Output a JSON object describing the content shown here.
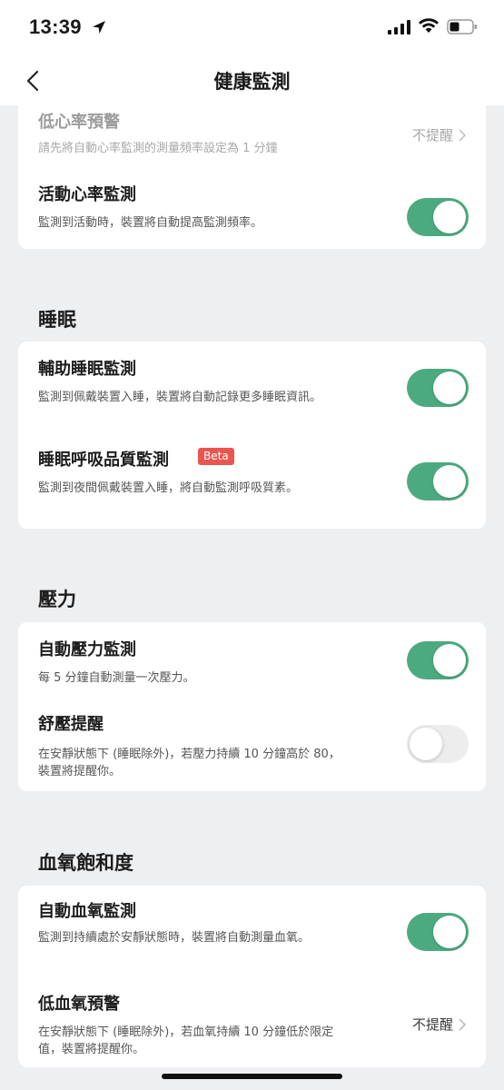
{
  "status": {
    "time": "13:39"
  },
  "nav": {
    "title": "健康監測"
  },
  "heart": {
    "low_hr": {
      "title": "低心率預警",
      "desc": "請先將自動心率監測的測量頻率設定為 1 分鐘",
      "value": "不提醒"
    },
    "activity_hr": {
      "title": "活動心率監測",
      "desc": "監測到活動時，裝置將自動提高監測頻率。",
      "toggle": true
    }
  },
  "sleep": {
    "header": "睡眠",
    "assist": {
      "title": "輔助睡眠監測",
      "desc": "監測到佩戴裝置入睡，裝置將自動記錄更多睡眠資訊。",
      "toggle": true
    },
    "breathing": {
      "title": "睡眠呼吸品質監測",
      "badge": "Beta",
      "desc": "監測到夜間佩戴裝置入睡，將自動監測呼吸質素。",
      "toggle": true
    }
  },
  "stress": {
    "header": "壓力",
    "auto": {
      "title": "自動壓力監測",
      "desc": "每 5 分鐘自動測量一次壓力。",
      "toggle": true
    },
    "relax": {
      "title": "舒壓提醒",
      "desc": "在安靜狀態下 (睡眠除外)，若壓力持續 10 分鐘高於 80，裝置將提醒你。",
      "toggle": false
    }
  },
  "spo2": {
    "header": "血氧飽和度",
    "auto": {
      "title": "自動血氧監測",
      "desc": "監測到持續處於安靜狀態時，裝置將自動測量血氧。",
      "toggle": true
    },
    "low": {
      "title": "低血氧預警",
      "desc": "在安靜狀態下 (睡眠除外)，若血氧持續 10 分鐘低於限定值，裝置將提醒你。",
      "value": "不提醒"
    }
  },
  "colors": {
    "accent": "#4caa80",
    "badge": "#e8564f",
    "background": "#eeeff1"
  },
  "icons": [
    "location-arrow-icon",
    "signal-icon",
    "wifi-icon",
    "battery-icon",
    "back-chevron-icon",
    "chevron-right-icon"
  ]
}
